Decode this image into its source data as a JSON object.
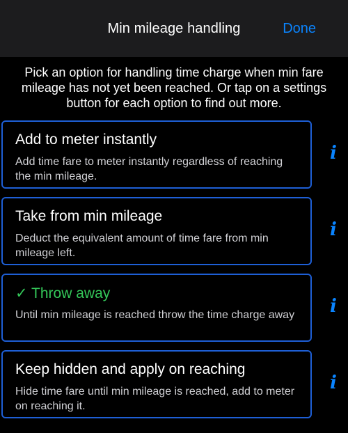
{
  "nav": {
    "title": "Min mileage handling",
    "done_label": "Done"
  },
  "description": "Pick an option for handling time charge when min fare mileage has not yet been reached. Or tap on a settings button for each option to find out more.",
  "options": [
    {
      "title": "Add to meter instantly",
      "description": "Add time fare to meter instantly regardless of reaching the min mileage.",
      "selected": false
    },
    {
      "title": "Take from min mileage",
      "description": "Deduct the equivalent amount of time fare from min mileage left.",
      "selected": false
    },
    {
      "title": "✓ Throw away",
      "description": "Until min mileage is reached throw the time charge away",
      "selected": true
    },
    {
      "title": "Keep hidden and apply on reaching",
      "description": "Hide time fare until min mileage is reached, add to meter on reaching it.",
      "selected": false
    }
  ],
  "info_icon": "i",
  "colors": {
    "accent": "#0a84ff",
    "selected": "#34c759",
    "card_border": "#1e5fd6",
    "nav_background": "#1c1c1e"
  }
}
